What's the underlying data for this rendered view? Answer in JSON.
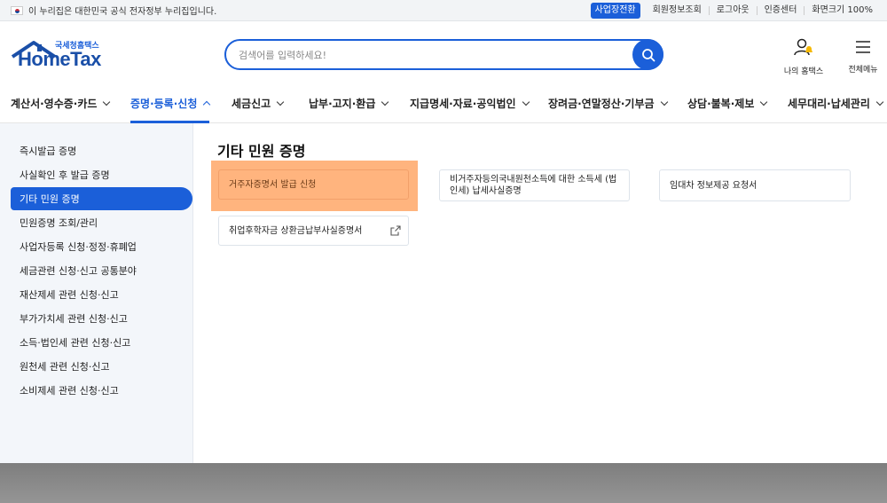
{
  "gov_bar": {
    "notice": "이 누리집은 대한민국 공식 전자정부 누리집입니다.",
    "business_badge": "사업장전환",
    "links": [
      "회원정보조회",
      "로그아웃",
      "인증센터",
      "화면크기 100%"
    ]
  },
  "header": {
    "logo_sub": "국세청홈택스",
    "logo_main": "HomeTax",
    "search_placeholder": "검색어를 입력하세요!",
    "my_home_label": "나의 홈택스",
    "all_menu_label": "전체메뉴"
  },
  "nav": {
    "items": [
      "계산서·영수증·카드",
      "증명·등록·신청",
      "세금신고",
      "납부·고지·환급",
      "지급명세·자료·공익법인",
      "장려금·연말정산·기부금",
      "상담·불복·제보",
      "세무대리·납세관리"
    ]
  },
  "sidebar": {
    "items": [
      "즉시발급 증명",
      "사실확인 후 발급 증명",
      "기타 민원 증명",
      "민원증명 조회/관리",
      "사업자등록 신청·정정·휴폐업",
      "세금관련 신청·신고 공통분야",
      "재산제세 관련 신청·신고",
      "부가가치세 관련 신청·신고",
      "소득·법인세 관련 신청·신고",
      "원천세 관련 신청·신고",
      "소비제세 관련 신청·신고"
    ]
  },
  "main": {
    "title": "기타 민원 증명",
    "cards": [
      "거주자증명서 발급 신청",
      "비거주자등의국내원천소득에 대한 소득세 (법인세) 납세사실증명",
      "임대차 정보제공 요청서",
      "취업후학자금 상환금납부사실증명서"
    ]
  },
  "colors": {
    "accent": "#1b5fd9",
    "highlight": "#ffb47e",
    "sidebar_bg": "#f3f6fa"
  }
}
